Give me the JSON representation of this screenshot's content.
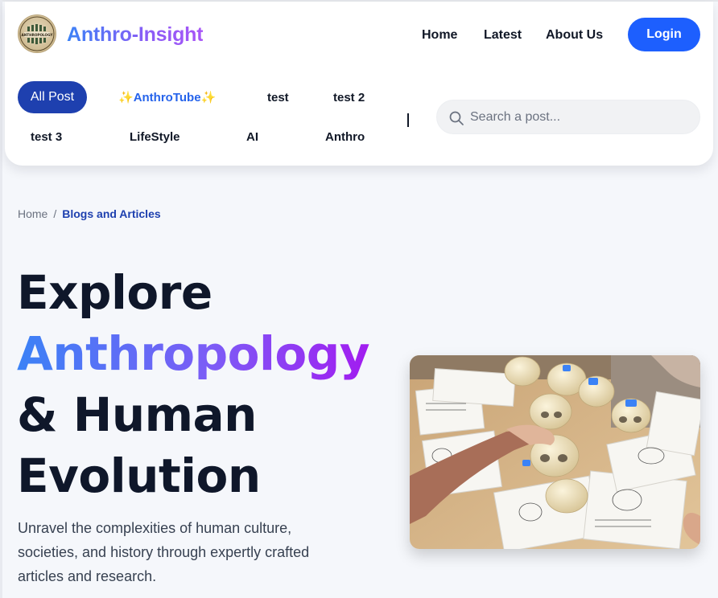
{
  "brand": {
    "name": "Anthro-Insight",
    "logo_icon": "anthropology-logo-icon",
    "logo_text": "ANTHROPOLOGY"
  },
  "nav": {
    "home": "Home",
    "latest": "Latest",
    "about": "About Us",
    "login": "Login"
  },
  "categories": {
    "all_post": "All Post",
    "anthrotube_sparkle": "✨",
    "anthrotube": "AnthroTube",
    "test": "test",
    "test2": "test 2",
    "test3": "test 3",
    "lifestyle": "LifeStyle",
    "ai": "AI",
    "anthro": "Anthro"
  },
  "search": {
    "placeholder": "Search a post...",
    "icon": "search-icon"
  },
  "breadcrumb": {
    "home": "Home",
    "separator": "/",
    "current": "Blogs and Articles"
  },
  "hero": {
    "line1": "Explore",
    "line2": "Anthropology",
    "line3": "& Human",
    "line4": "Evolution",
    "subtitle": "Unravel the complexities of human culture, societies, and history through expertly crafted articles and research.",
    "image": "skulls-on-table-photo"
  },
  "colors": {
    "accent": "#1d5ffe",
    "active_category": "#1e40af",
    "gradient_start": "#3b82f6",
    "gradient_end": "#a855f7"
  }
}
